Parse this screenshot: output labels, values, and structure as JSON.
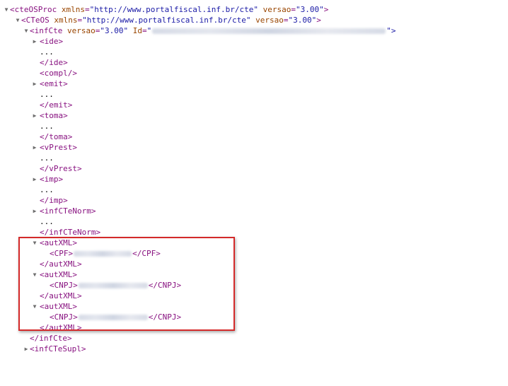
{
  "tree": {
    "l1_open": "<cteOSProc ",
    "l1_attr1_name": "xmlns",
    "l1_attr1_value": "\"http://www.portalfiscal.inf.br/cte\"",
    "l1_attr2_name": "versao",
    "l1_attr2_value": "\"3.00\"",
    "l2_open": "<CTeOS ",
    "l2_attr1_name": "xmlns",
    "l2_attr1_value": "\"http://www.portalfiscal.inf.br/cte\"",
    "l2_attr2_name": "versao",
    "l2_attr2_value": "\"3.00\"",
    "l3_open": "<infCte ",
    "l3_attr1_name": "versao",
    "l3_attr1_value": "\"3.00\"",
    "l3_attr2_name": "Id",
    "l3_attr2_value_open": "\"",
    "l3_attr2_value_close": "\">",
    "ide_open": "<ide>",
    "ide_close": "</ide>",
    "compl": "<compl/>",
    "emit_open": "<emit>",
    "emit_close": "</emit>",
    "toma_open": "<toma>",
    "toma_close": "</toma>",
    "vprest_open": "<vPrest>",
    "vprest_close": "</vPrest>",
    "imp_open": "<imp>",
    "imp_close": "</imp>",
    "infctenorm_open": "<infCTeNorm>",
    "infctenorm_close": "</infCTeNorm>",
    "autxml_open": "<autXML>",
    "autxml_close": "</autXML>",
    "cpf_open": "<CPF>",
    "cpf_close": "</CPF>",
    "cnpj_open": "<CNPJ>",
    "cnpj_close": "</CNPJ>",
    "infcte_close": "</infCte>",
    "infctesupl_open": "<infCTeSupl>",
    "ellipsis": "...",
    "gt": ">",
    "eq": "="
  },
  "icons": {
    "expanded": "▼",
    "collapsed": "▶"
  },
  "colors": {
    "tag": "#881280",
    "attr_name": "#994500",
    "attr_value": "#1a1aa6",
    "highlight": "#d42a2a"
  }
}
